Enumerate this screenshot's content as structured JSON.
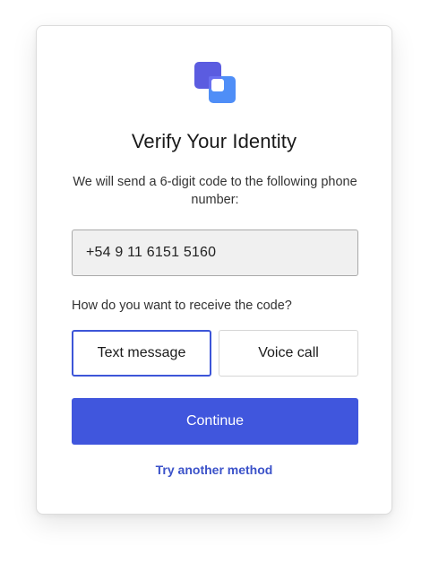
{
  "brand": {
    "logo_icon": "overlapping-squares-logo",
    "colors": {
      "logo_back": "#5b5ce0",
      "logo_front": "#4f8ef7",
      "accent": "#4056dd",
      "link": "#3b52c9"
    }
  },
  "header": {
    "title": "Verify Your Identity"
  },
  "description": "We will send a 6-digit code to the following phone number:",
  "phone": {
    "value": "+54 9 11 6151 5160"
  },
  "delivery": {
    "question": "How do you want to receive the code?",
    "options": [
      {
        "label": "Text message",
        "selected": true
      },
      {
        "label": "Voice call",
        "selected": false
      }
    ]
  },
  "actions": {
    "continue_label": "Continue",
    "alternate_label": "Try another method"
  }
}
